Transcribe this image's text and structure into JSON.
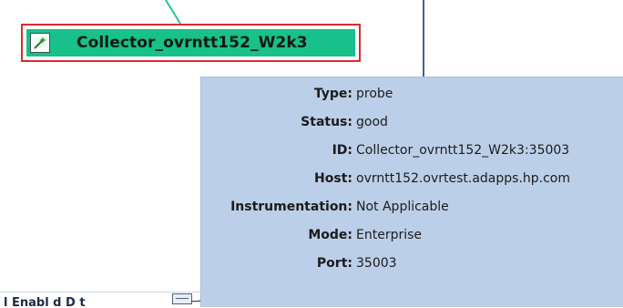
{
  "colors": {
    "node_fill": "#18c08a",
    "node_selected_border": "#e02a2a",
    "edge": "#26c39a",
    "tooltip_bg": "#bccfe8",
    "panel_border": "#3f5f9f"
  },
  "node": {
    "label": "Collector_ovrntt152_W2k3",
    "icon": "wand-icon",
    "selected": true
  },
  "tooltip": {
    "rows": [
      {
        "key": "Type:",
        "value": "probe"
      },
      {
        "key": "Status:",
        "value": "good"
      },
      {
        "key": "ID:",
        "value": "Collector_ovrntt152_W2k3:35003"
      },
      {
        "key": "Host:",
        "value": "ovrntt152.ovrtest.adapps.hp.com"
      },
      {
        "key": "Instrumentation:",
        "value": "Not Applicable"
      },
      {
        "key": "Mode:",
        "value": "Enterprise"
      },
      {
        "key": "Port:",
        "value": "35003"
      }
    ]
  },
  "bottom_bar": {
    "partial_text": "l  Enabl d  D t",
    "collapse_icon": "collapse-icon"
  }
}
